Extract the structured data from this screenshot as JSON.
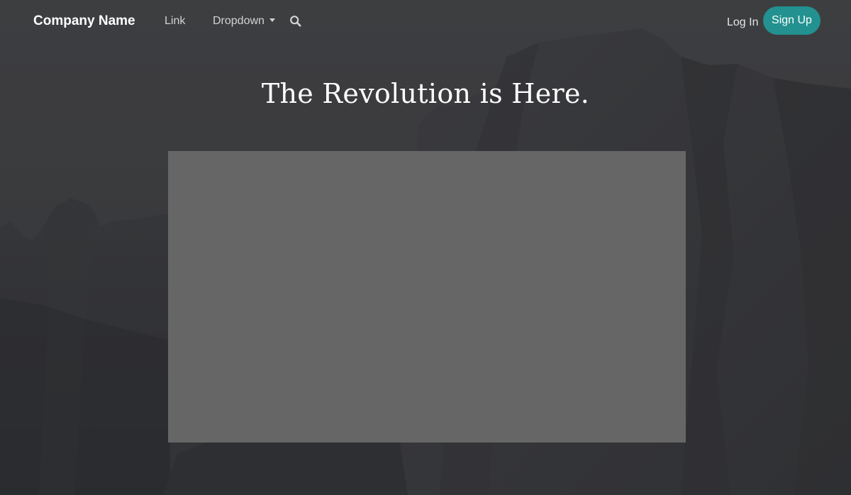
{
  "navbar": {
    "brand": "Company Name",
    "links": [
      {
        "label": "Link"
      },
      {
        "label": "Dropdown",
        "has_caret": true
      }
    ],
    "search_icon": "search-icon",
    "login_label": "Log In",
    "signup_label": "Sign Up"
  },
  "hero": {
    "headline": "The Revolution is Here.",
    "background": "dark mountain cliff photograph"
  },
  "colors": {
    "accent": "#22918f",
    "placeholder": "#666666",
    "background": "#3b3c3e",
    "text": "#ffffff"
  }
}
